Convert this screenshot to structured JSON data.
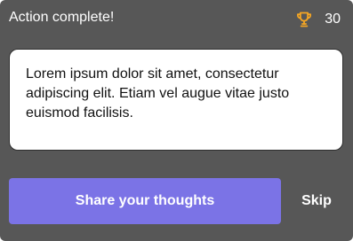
{
  "header": {
    "title": "Action complete!",
    "score": "30",
    "score_icon": "trophy-icon"
  },
  "message": {
    "text": "Lorem ipsum dolor sit amet, consectetur adipiscing elit. Etiam vel augue vitae justo euismod facilisis."
  },
  "actions": {
    "share_label": "Share your thoughts",
    "skip_label": "Skip"
  },
  "colors": {
    "card_background": "#575757",
    "accent_button": "#7b73e6",
    "trophy": "#f5a623",
    "text_light": "#ffffff"
  }
}
